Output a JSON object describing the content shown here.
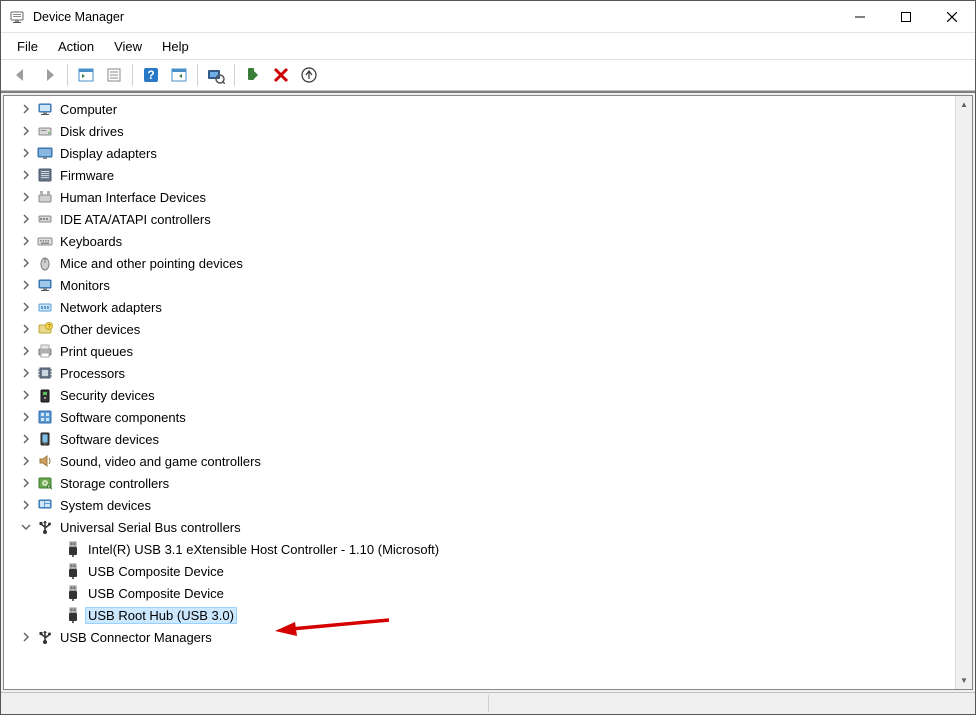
{
  "app": {
    "title": "Device Manager"
  },
  "menu": {
    "file": "File",
    "action": "Action",
    "view": "View",
    "help": "Help"
  },
  "tree": {
    "items": [
      {
        "label": "Computer",
        "icon": "computer"
      },
      {
        "label": "Disk drives",
        "icon": "disk"
      },
      {
        "label": "Display adapters",
        "icon": "display"
      },
      {
        "label": "Firmware",
        "icon": "firmware"
      },
      {
        "label": "Human Interface Devices",
        "icon": "hid"
      },
      {
        "label": "IDE ATA/ATAPI controllers",
        "icon": "ide"
      },
      {
        "label": "Keyboards",
        "icon": "keyboard"
      },
      {
        "label": "Mice and other pointing devices",
        "icon": "mouse"
      },
      {
        "label": "Monitors",
        "icon": "monitor"
      },
      {
        "label": "Network adapters",
        "icon": "network"
      },
      {
        "label": "Other devices",
        "icon": "other"
      },
      {
        "label": "Print queues",
        "icon": "printer"
      },
      {
        "label": "Processors",
        "icon": "cpu"
      },
      {
        "label": "Security devices",
        "icon": "security"
      },
      {
        "label": "Software components",
        "icon": "swcomp"
      },
      {
        "label": "Software devices",
        "icon": "swdev"
      },
      {
        "label": "Sound, video and game controllers",
        "icon": "sound"
      },
      {
        "label": "Storage controllers",
        "icon": "storage"
      },
      {
        "label": "System devices",
        "icon": "system"
      },
      {
        "label": "Universal Serial Bus controllers",
        "icon": "usb",
        "expanded": true,
        "children": [
          {
            "label": "Intel(R) USB 3.1 eXtensible Host Controller - 1.10 (Microsoft)",
            "icon": "usbplug"
          },
          {
            "label": "USB Composite Device",
            "icon": "usbplug"
          },
          {
            "label": "USB Composite Device",
            "icon": "usbplug"
          },
          {
            "label": "USB Root Hub (USB 3.0)",
            "icon": "usbplug",
            "selected": true
          }
        ]
      },
      {
        "label": "USB Connector Managers",
        "icon": "usb"
      }
    ]
  }
}
